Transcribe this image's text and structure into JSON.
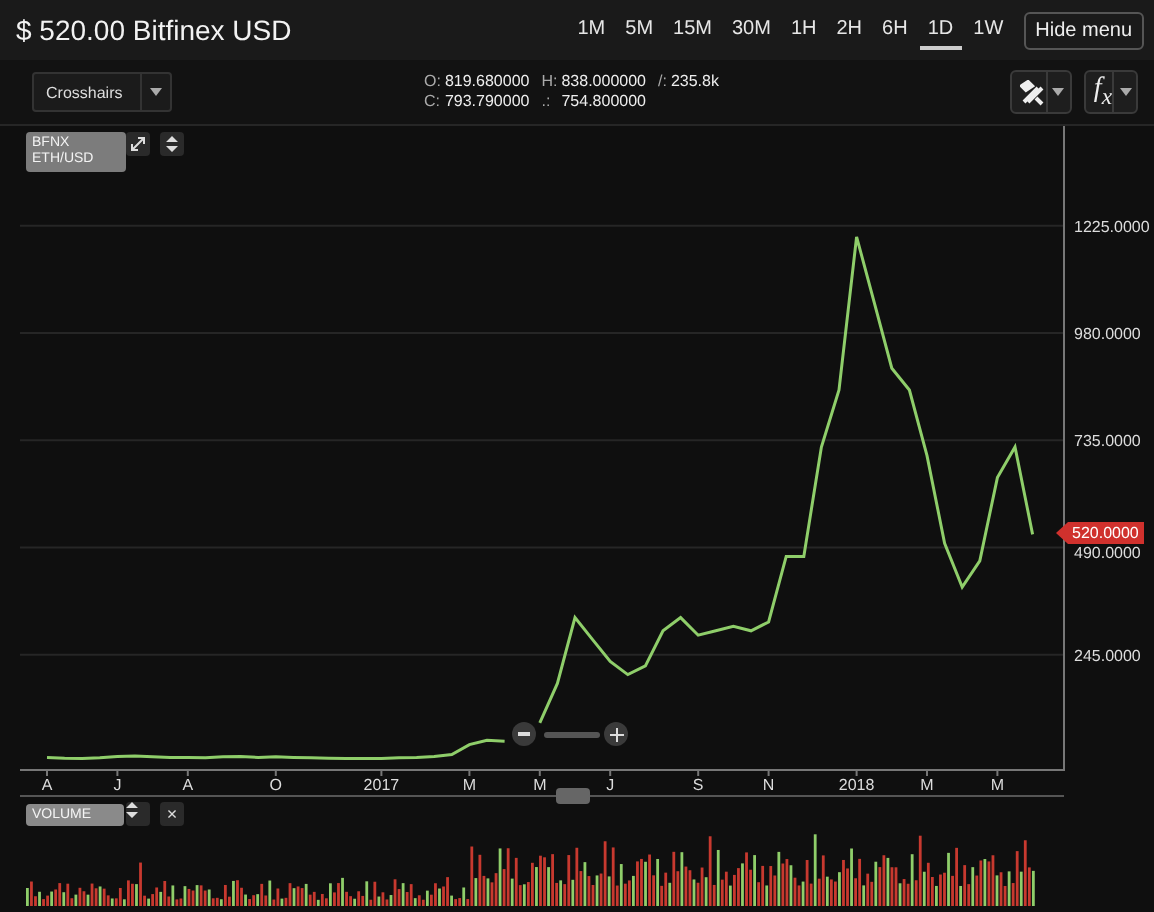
{
  "header": {
    "title": "$ 520.00 Bitfinex USD",
    "intervals": [
      {
        "label": "1M",
        "selected": false
      },
      {
        "label": "5M",
        "selected": false
      },
      {
        "label": "15M",
        "selected": false
      },
      {
        "label": "30M",
        "selected": false
      },
      {
        "label": "1H",
        "selected": false
      },
      {
        "label": "2H",
        "selected": false
      },
      {
        "label": "6H",
        "selected": false
      },
      {
        "label": "1D",
        "selected": true
      },
      {
        "label": "1W",
        "selected": false
      }
    ],
    "hide_button": "Hide menu"
  },
  "toolbar": {
    "cursor_select": "Crosshairs",
    "ohlc": [
      {
        "label": "O:",
        "value": "819.680000"
      },
      {
        "label": "H:",
        "value": "838.000000"
      },
      {
        "label": "/:",
        "value": "235.8k"
      },
      {
        "label": "C:",
        "value": "793.790000"
      },
      {
        "label": ".:",
        "value": "754.800000"
      }
    ],
    "function_button": "f$_{x}$"
  },
  "chart": {
    "exchange_label": "BFNX",
    "last_price_tag": "520.0000",
    "chart_data": {
      "type": "line",
      "grid": true,
      "ylim": [
        -18,
        1453
      ],
      "categories": [
        "A",
        null,
        null,
        null,
        "J",
        null,
        null,
        null,
        "A",
        null,
        null,
        null,
        null,
        "O",
        null,
        null,
        null,
        null,
        null,
        "2017",
        null,
        null,
        null,
        null,
        "M",
        null,
        null,
        null,
        "M",
        null,
        null,
        null,
        "J",
        null,
        null,
        null,
        null,
        "S",
        null,
        null,
        null,
        "N",
        null,
        null,
        null,
        null,
        "2018",
        null,
        null,
        null,
        "M",
        null,
        null,
        null,
        "M",
        null,
        null
      ],
      "series": [
        {
          "name": "ETH/USD",
          "color": "#8fce6a",
          "values": [
            11,
            9,
            8,
            10,
            13,
            14,
            12,
            11,
            11,
            10,
            12,
            13,
            11,
            12,
            11,
            10,
            9,
            8,
            8,
            8,
            10,
            11,
            13,
            17,
            40,
            50,
            48,
            null,
            90,
            180,
            330,
            280,
            230,
            200,
            220,
            300,
            330,
            290,
            300,
            310,
            300,
            320,
            470,
            470,
            720,
            850,
            1200,
            1050,
            900,
            850,
            700,
            500,
            400,
            460,
            650,
            720,
            520
          ]
        }
      ],
      "yticks": [
        {
          "value": 245,
          "label": "245.0000"
        },
        {
          "value": 490,
          "label": "490.0000"
        },
        {
          "value": 735,
          "label": "735.0000"
        },
        {
          "value": 980,
          "label": "980.0000"
        },
        {
          "value": 1225,
          "label": "1225.0000"
        }
      ]
    }
  },
  "volume": {
    "label": "VOLUME",
    "close": "×"
  }
}
